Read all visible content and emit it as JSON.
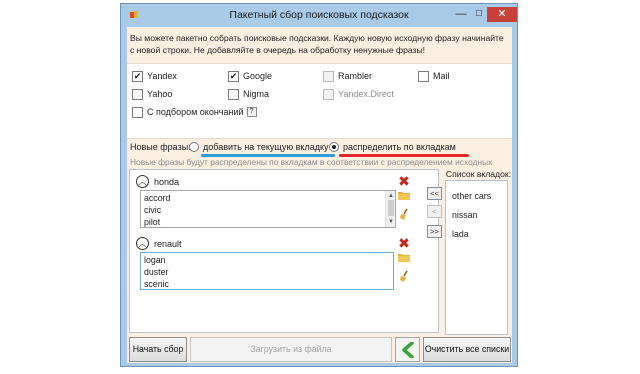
{
  "window": {
    "title": "Пакетный сбор поисковых подсказок",
    "controls": {
      "minimize": "—",
      "maximize": "□",
      "close": "✕"
    }
  },
  "info_text": "Вы можете пакетно собрать поисковые подсказки. Каждую новую исходную фразу начинайте с новой строки. Не добавляйте в очередь на обработку ненужные фразы!",
  "engines": [
    {
      "label": "Yandex",
      "checked": true,
      "enabled": true
    },
    {
      "label": "Google",
      "checked": true,
      "enabled": true
    },
    {
      "label": "Rambler",
      "checked": false,
      "enabled": false
    },
    {
      "label": "Mail",
      "checked": false,
      "enabled": true
    },
    {
      "label": "Yahoo",
      "checked": false,
      "enabled": true
    },
    {
      "label": "Nigma",
      "checked": false,
      "enabled": true
    },
    {
      "label": "Yandex.Direct",
      "checked": false,
      "enabled": false
    }
  ],
  "endings_option": {
    "label": "С подбором окончаний",
    "help": "?",
    "checked": false
  },
  "new_phrases": {
    "label": "Новые фразы:",
    "option_current": "добавить на текущую вкладку",
    "option_distribute": "распределить по вкладкам",
    "selected": "distribute",
    "hint": "Новые фразы будут распределены по вкладкам в соответствии с распределением исходных фраз.",
    "underline_colors": {
      "current": "#2f9ed8",
      "distribute": "#e8252d"
    }
  },
  "groups": [
    {
      "name": "honda",
      "text": "accord\ncivic\npilot"
    },
    {
      "name": "renault",
      "text": "logan\nduster\nscenic"
    }
  ],
  "tabs_panel": {
    "label": "Список вкладок:",
    "buttons": {
      "all_left": "<<",
      "left": "<",
      "right": ">>"
    },
    "items": [
      "other cars",
      "nissan",
      "lada"
    ]
  },
  "footer": {
    "start": "Начать сбор",
    "load": "Загрузить из файла",
    "clear_all": "Очистить все списки"
  },
  "icons": {
    "remove": "red-x-icon",
    "open": "folder-icon",
    "clear": "broom-icon",
    "collapse": "chevron-up-icon",
    "back": "green-back-arrow-icon"
  },
  "colors": {
    "window_border": "#a9cbe7",
    "panel_bg": "#fbefe2",
    "close_button": "#c7403a",
    "back_arrow": "#3aa33a"
  }
}
